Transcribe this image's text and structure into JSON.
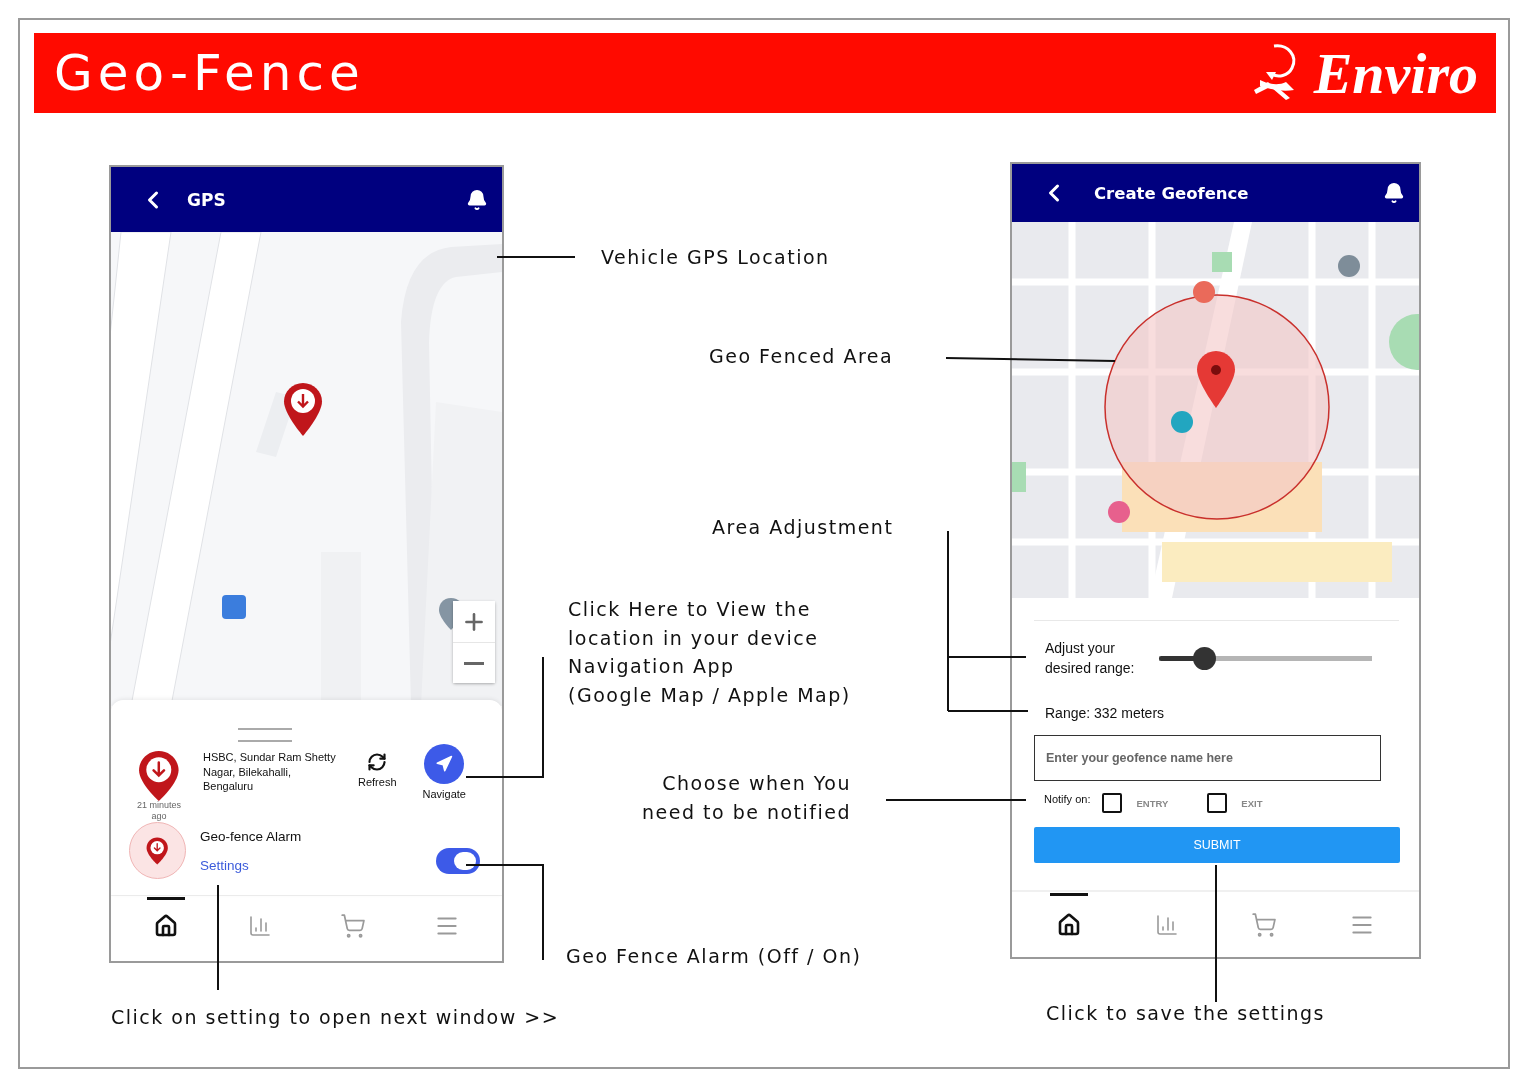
{
  "header": {
    "title": "Geo-Fence",
    "logo_text": "Enviro"
  },
  "gps_screen": {
    "title": "GPS",
    "location": {
      "address": "HSBC,  Sundar Ram Shetty Nagar,  Bilekahalli, Bengaluru",
      "time": "21 minutes ago"
    },
    "refresh_label": "Refresh",
    "navigate_label": "Navigate",
    "alarm": {
      "title": "Geo-fence Alarm",
      "settings_link": "Settings",
      "on": true
    },
    "nav_items": [
      {
        "kind": "home",
        "selected": true
      },
      {
        "kind": "chart",
        "selected": false
      },
      {
        "kind": "cart",
        "selected": false
      },
      {
        "kind": "menu",
        "selected": false
      }
    ]
  },
  "geofence_screen": {
    "title": "Create Geofence",
    "range_label": "Adjust your desired range:",
    "range": {
      "level": 0.2
    },
    "range_reading": "Range: 332 meters",
    "name_field": {
      "placeholder": "Enter your geofence name here"
    },
    "notify_label": "Notify on:",
    "notify_options": [
      {
        "label": "ENTRY",
        "checked": false
      },
      {
        "label": "EXIT",
        "checked": false
      }
    ],
    "submit": "SUBMIT",
    "nav_items": [
      {
        "kind": "home",
        "selected": true
      },
      {
        "kind": "chart",
        "selected": false
      },
      {
        "kind": "cart",
        "selected": false
      },
      {
        "kind": "menu",
        "selected": false
      }
    ]
  },
  "annotations": [
    {
      "lines": [
        "Vehicle GPS Location"
      ]
    },
    {
      "lines": [
        "Geo Fenced Area"
      ]
    },
    {
      "lines": [
        "Area Adjustment"
      ]
    },
    {
      "lines": [
        "Click Here to View the",
        "location in your device",
        "Navigation App",
        "(Google Map / Apple Map)"
      ]
    },
    {
      "lines": [
        "Choose when You",
        "need to be notified"
      ]
    },
    {
      "lines": [
        "Geo Fence Alarm (Off / On)"
      ]
    },
    {
      "lines": [
        "Click on setting to open next window  >>"
      ]
    },
    {
      "lines": [
        "Click to save the settings"
      ]
    }
  ]
}
